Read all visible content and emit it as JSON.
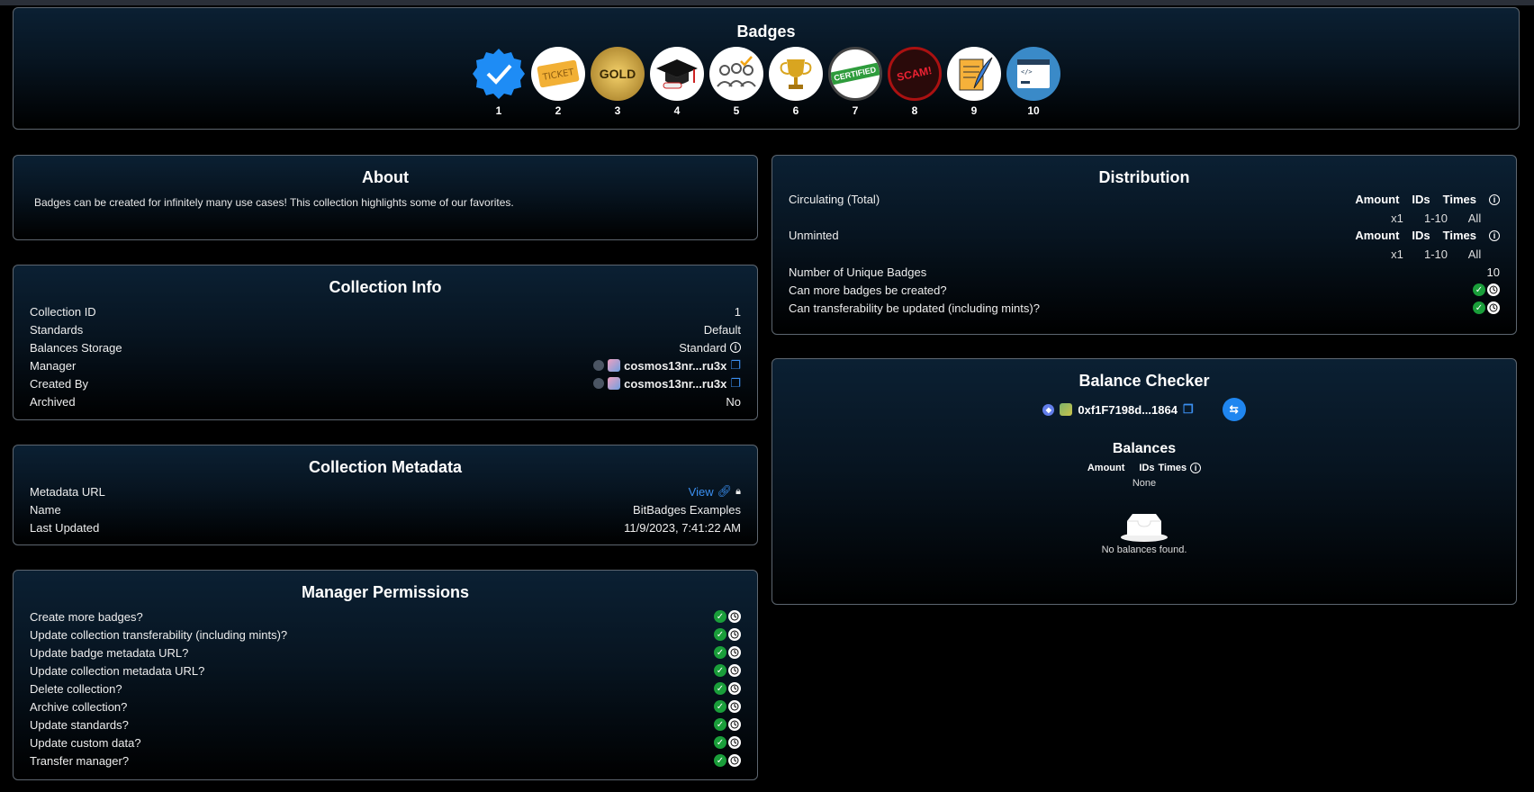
{
  "badges": {
    "title": "Badges",
    "items": [
      {
        "num": "1",
        "icon": "verified-check-badge"
      },
      {
        "num": "2",
        "icon": "ticket-badge"
      },
      {
        "num": "3",
        "icon": "gold-membership-badge",
        "text": "GOLD"
      },
      {
        "num": "4",
        "icon": "graduation-cap-badge"
      },
      {
        "num": "5",
        "icon": "group-check-badge"
      },
      {
        "num": "6",
        "icon": "trophy-badge"
      },
      {
        "num": "7",
        "icon": "certified-badge",
        "text": "CERTIFIED"
      },
      {
        "num": "8",
        "icon": "scam-stamp-badge",
        "text": "SCAM!"
      },
      {
        "num": "9",
        "icon": "document-quill-badge"
      },
      {
        "num": "10",
        "icon": "code-window-badge"
      }
    ]
  },
  "about": {
    "title": "About",
    "text": "Badges can be created for infinitely many use cases! This collection highlights some of our favorites."
  },
  "collection_info": {
    "title": "Collection Info",
    "rows": {
      "collection_id": {
        "label": "Collection ID",
        "value": "1"
      },
      "standards": {
        "label": "Standards",
        "value": "Default"
      },
      "balances_storage": {
        "label": "Balances Storage",
        "value": "Standard"
      },
      "manager": {
        "label": "Manager",
        "value": "cosmos13nr...ru3x"
      },
      "created_by": {
        "label": "Created By",
        "value": "cosmos13nr...ru3x"
      },
      "archived": {
        "label": "Archived",
        "value": "No"
      }
    }
  },
  "collection_metadata": {
    "title": "Collection Metadata",
    "metadata_url": {
      "label": "Metadata URL",
      "value": "View"
    },
    "name": {
      "label": "Name",
      "value": "BitBadges Examples"
    },
    "last_updated": {
      "label": "Last Updated",
      "value": "11/9/2023, 7:41:22 AM"
    }
  },
  "permissions": {
    "title": "Manager Permissions",
    "items": [
      "Create more badges?",
      "Update collection transferability (including mints)?",
      "Update badge metadata URL?",
      "Update collection metadata URL?",
      "Delete collection?",
      "Archive collection?",
      "Update standards?",
      "Update custom data?",
      "Transfer manager?"
    ]
  },
  "distribution": {
    "title": "Distribution",
    "headers": {
      "amount": "Amount",
      "ids": "IDs",
      "times": "Times"
    },
    "circulating": {
      "label": "Circulating (Total)",
      "amount": "x1",
      "ids": "1-10",
      "times": "All"
    },
    "unminted": {
      "label": "Unminted",
      "amount": "x1",
      "ids": "1-10",
      "times": "All"
    },
    "unique": {
      "label": "Number of Unique Badges",
      "value": "10"
    },
    "more_badges": {
      "label": "Can more badges be created?"
    },
    "transferability": {
      "label": "Can transferability be updated (including mints)?"
    }
  },
  "balance_checker": {
    "title": "Balance Checker",
    "address": "0xf1F7198d...1864",
    "balances_title": "Balances",
    "headers": {
      "amount": "Amount",
      "ids": "IDs",
      "times": "Times"
    },
    "none": "None",
    "empty": "No balances found."
  },
  "colors": {
    "accent": "#3b8ff0",
    "success": "#1a9e3a",
    "border": "#5d6670"
  }
}
